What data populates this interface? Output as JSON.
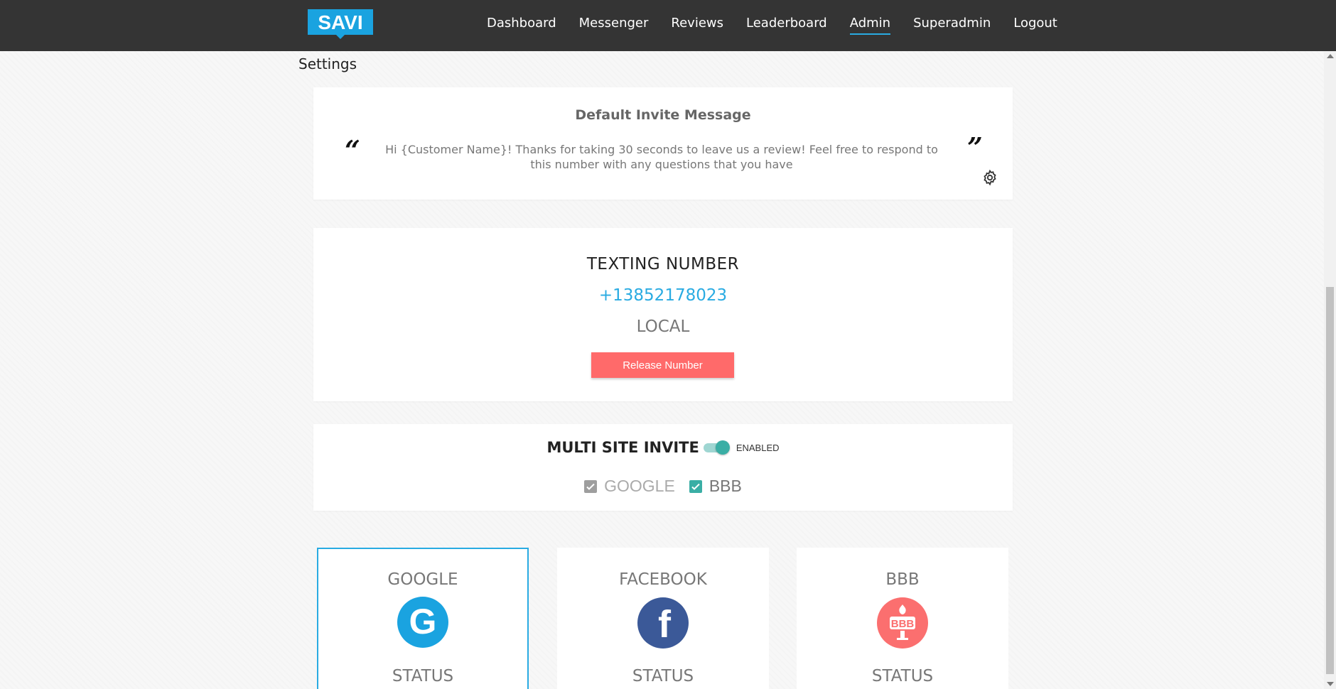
{
  "nav": {
    "logo_text": "SAVI",
    "items": [
      {
        "label": "Dashboard",
        "active": false
      },
      {
        "label": "Messenger",
        "active": false
      },
      {
        "label": "Reviews",
        "active": false
      },
      {
        "label": "Leaderboard",
        "active": false
      },
      {
        "label": "Admin",
        "active": true
      },
      {
        "label": "Superadmin",
        "active": false
      },
      {
        "label": "Logout",
        "active": false
      }
    ]
  },
  "page": {
    "title": "Settings"
  },
  "invite": {
    "title": "Default Invite Message",
    "message": "Hi {Customer Name}! Thanks for taking 30 seconds to leave us a review! Feel free to respond to this number with any questions that you have"
  },
  "texting": {
    "label": "TEXTING NUMBER",
    "number": "+13852178023",
    "type": "LOCAL",
    "release_label": "Release Number"
  },
  "multi_site": {
    "title": "MULTI SITE INVITE",
    "toggle_label": "ENABLED",
    "enabled": true,
    "options": [
      {
        "label": "GOOGLE",
        "checked": true,
        "disabled": true
      },
      {
        "label": "BBB",
        "checked": true,
        "disabled": false
      }
    ]
  },
  "sites": [
    {
      "name": "GOOGLE",
      "status": "STATUS",
      "selected": true,
      "color": "#1aa3e0",
      "icon": "google-icon",
      "glyph": "G"
    },
    {
      "name": "FACEBOOK",
      "status": "STATUS",
      "selected": false,
      "color": "#3b5998",
      "icon": "facebook-icon",
      "glyph": "f"
    },
    {
      "name": "BBB",
      "status": "STATUS",
      "selected": false,
      "color": "#fb6f6f",
      "icon": "bbb-icon",
      "glyph": "BBB"
    }
  ],
  "colors": {
    "navbar": "#343434",
    "accent": "#29abe2",
    "danger": "#ff6a6a",
    "teal": "#3aaea5"
  }
}
